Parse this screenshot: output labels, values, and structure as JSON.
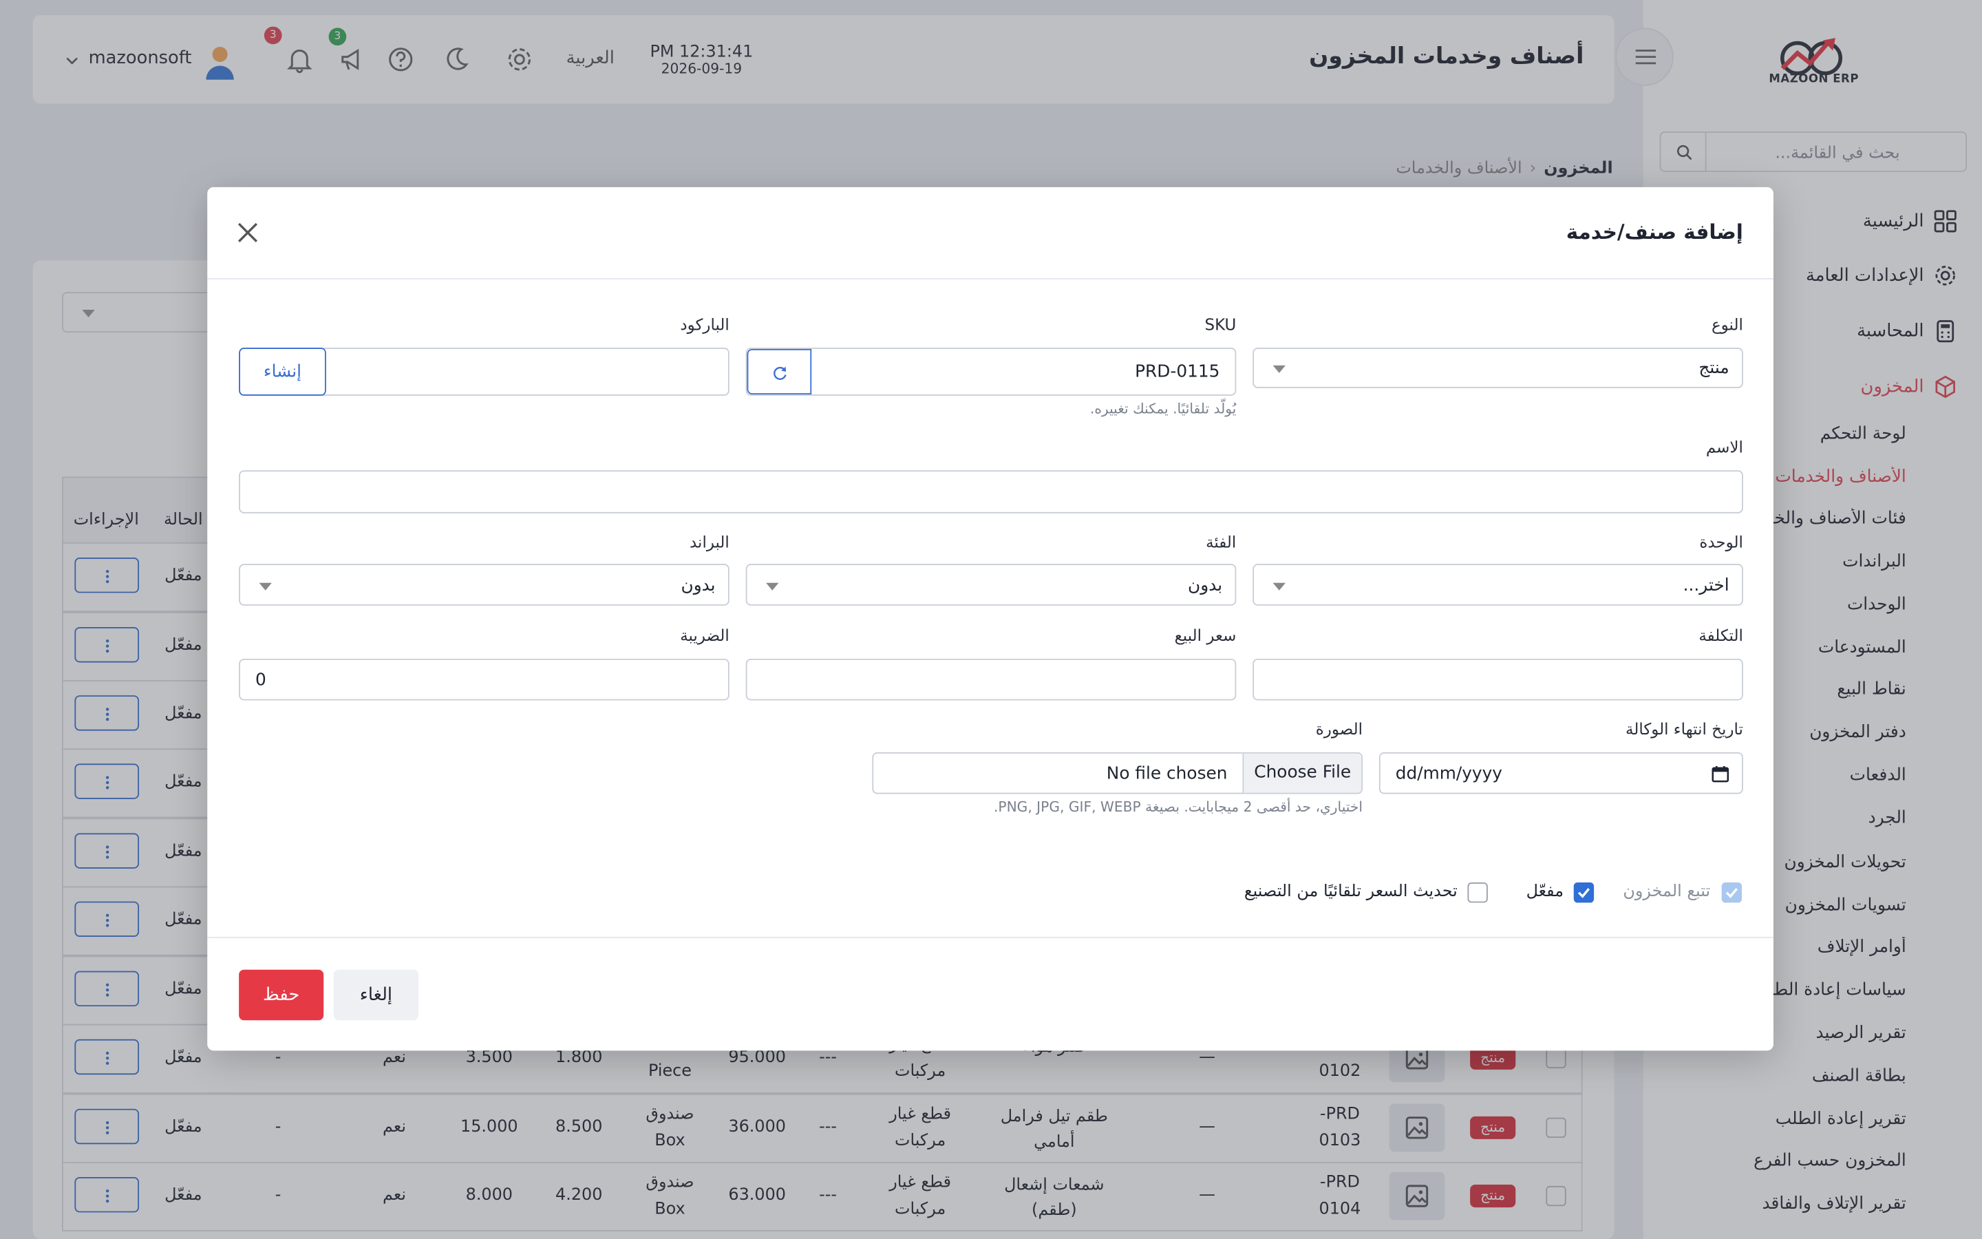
{
  "app": {
    "logo_text": "MAZOON ERP"
  },
  "sidebar": {
    "search_placeholder": "بحث في القائمة...",
    "items": [
      {
        "label": "الرئيسية",
        "icon": "grid-icon"
      },
      {
        "label": "الإعدادات العامة",
        "icon": "gear-icon"
      },
      {
        "label": "المحاسبة",
        "icon": "calculator-icon"
      },
      {
        "label": "المخزون",
        "icon": "box-icon",
        "active": true
      }
    ],
    "inventory_sub": [
      "لوحة التحكم",
      "الأصناف والخدمات",
      "فئات الأصناف والخدمات",
      "البراندات",
      "الوحدات",
      "المستودعات",
      "نقاط البيع",
      "دفتر المخزون",
      "الدفعات",
      "الجرد",
      "تحويلات المخزون",
      "تسويات المخزون",
      "أوامر الإتلاف",
      "سياسات إعادة الطلب",
      "تقرير الرصيد",
      "بطاقة الصنف",
      "تقرير إعادة الطلب",
      "المخزون حسب الفرع",
      "تقرير الإتلاف والفاقد"
    ]
  },
  "topbar": {
    "title": "أصناف وخدمات المخزون",
    "time": "PM 12:31:41",
    "date": "2026-09-19",
    "language": "العربية",
    "username": "mazoonsoft",
    "notifications_count": "3",
    "announcements_count": "3"
  },
  "breadcrumb": {
    "root": "المخزون",
    "current": "الأصناف والخدمات"
  },
  "table": {
    "headers": {
      "actions": "الإجراءات",
      "status": "الحالة"
    },
    "status_values": [
      "مفعّل",
      "مفعّل",
      "مفعّل",
      "مفعّل",
      "مفعّل",
      "مفعّل",
      "مفعّل",
      "مفعّل",
      "مفعّل",
      "مفعّل"
    ],
    "rows": [
      {
        "sku_a": "PRD-",
        "sku_b": "0102",
        "type": "منتج",
        "name": "فلتر هواء",
        "category_a": "قطع غيار",
        "category_b": "مركبات",
        "dash3": "---",
        "price": "95.000",
        "unit_a": "",
        "unit_b": "Piece",
        "cost": "1.800",
        "qty": "3.500",
        "track": "نعم",
        "dash1": "-",
        "dash2": "—"
      },
      {
        "sku_a": "PRD-",
        "sku_b": "0103",
        "type": "منتج",
        "name": "طقم تيل فرامل أمامي",
        "category_a": "قطع غيار",
        "category_b": "مركبات",
        "dash3": "---",
        "price": "36.000",
        "unit_a": "صندوق",
        "unit_b": "Box",
        "cost": "8.500",
        "qty": "15.000",
        "track": "نعم",
        "dash1": "-",
        "dash2": "—"
      },
      {
        "sku_a": "PRD-",
        "sku_b": "0104",
        "type": "منتج",
        "name": "شمعات إشعال (طقم)",
        "category_a": "قطع غيار",
        "category_b": "مركبات",
        "dash3": "---",
        "price": "63.000",
        "unit_a": "صندوق",
        "unit_b": "Box",
        "cost": "4.200",
        "qty": "8.000",
        "track": "نعم",
        "dash1": "-",
        "dash2": "—"
      }
    ]
  },
  "modal": {
    "title": "إضافة صنف/خدمة",
    "fields": {
      "type_label": "النوع",
      "type_value": "منتج",
      "sku_label": "SKU",
      "sku_value": "PRD-0115",
      "sku_hint": "يُولّد تلقائيًا. يمكنك تغييره.",
      "barcode_label": "الباركود",
      "barcode_value": "",
      "barcode_generate": "إنشاء",
      "name_label": "الاسم",
      "name_value": "",
      "unit_label": "الوحدة",
      "unit_value": "اختر...",
      "category_label": "الفئة",
      "category_value": "بدون",
      "brand_label": "البراند",
      "brand_value": "بدون",
      "cost_label": "التكلفة",
      "cost_value": "",
      "price_label": "سعر البيع",
      "price_value": "",
      "tax_label": "الضريبة",
      "tax_value": "0",
      "warranty_label": "تاريخ انتهاء الوكالة",
      "warranty_placeholder": "dd/mm/yyyy",
      "image_label": "الصورة",
      "choose_file": "Choose File",
      "no_file": "No file chosen",
      "image_hint": "اختياري، حد أقصى 2 ميجابايت. بصيغة PNG, JPG, GIF, WEBP."
    },
    "checkboxes": {
      "track_stock": "تتبع المخزون",
      "active": "مفعّل",
      "auto_price": "تحديث السعر تلقائيًا من التصنيع"
    },
    "buttons": {
      "cancel": "إلغاء",
      "save": "حفظ"
    }
  },
  "colors": {
    "accent": "#e53946",
    "primary": "#2f6fd6",
    "active_side": "#e04755"
  }
}
